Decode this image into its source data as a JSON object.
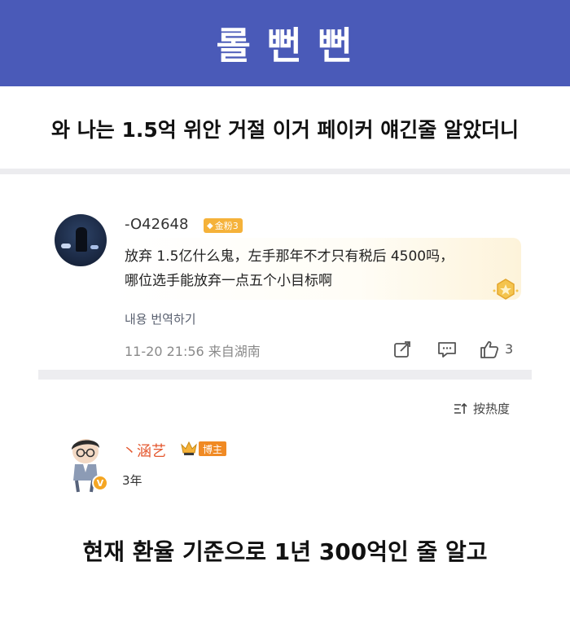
{
  "banner": {
    "title": "롤 뻔 뻔"
  },
  "post": {
    "subtitle": "와 나는 1.5억 위안 거절 이거 페이커 얘긴줄 알았더니"
  },
  "comment": {
    "username": "-O42648",
    "fan_badge": "金粉3",
    "text_line1": "放弃 1.5亿什么鬼，左手那年不才只有税后 4500吗，",
    "text_line2": "哪位选手能放弃一点五个小目标啊",
    "translate_label": "내용 번역하기",
    "timestamp": "11-20 21:56  来自湖南",
    "like_count": "3",
    "icons": [
      "share-icon",
      "comment-icon",
      "like-icon",
      "medal-icon"
    ]
  },
  "sort": {
    "label": "按热度"
  },
  "reply": {
    "username": "丶涵艺",
    "role_badge": "博主",
    "verified_mark": "V",
    "meta": "3年"
  },
  "caption": "현재 환율 기준으로 1년 300억인 줄 알고",
  "colors": {
    "banner_bg": "#4a5ab8",
    "fan_badge": "#f5b23a",
    "blogger_badge": "#f08a24",
    "reply_name": "#e4572e"
  }
}
